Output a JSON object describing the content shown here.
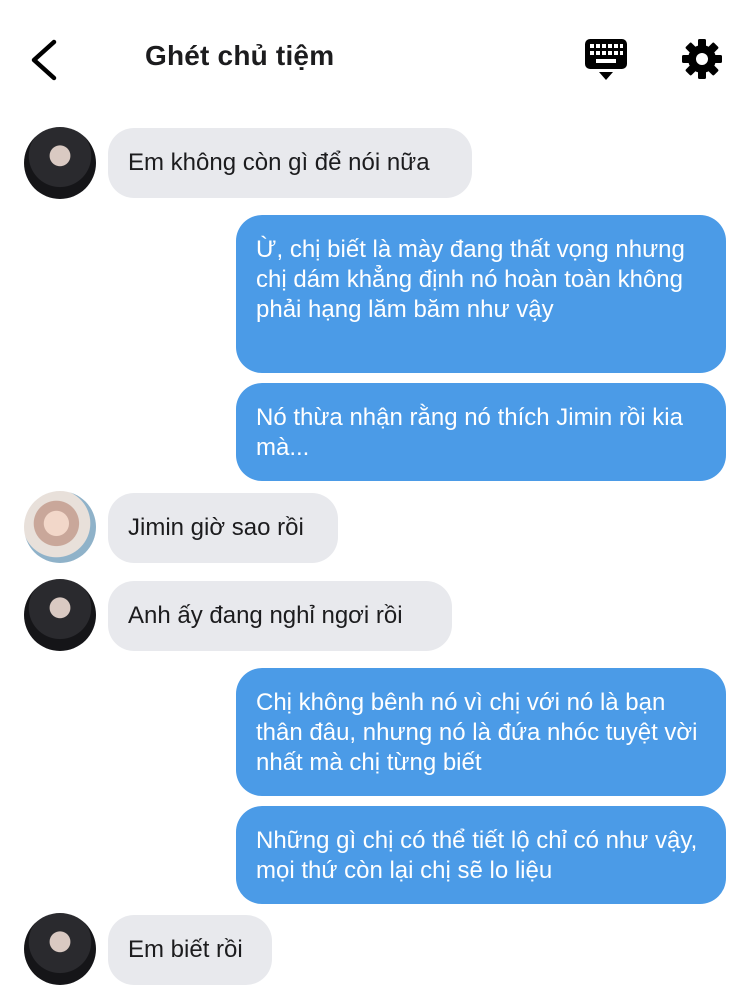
{
  "header": {
    "title": "Ghét chủ tiệm",
    "back_icon": "chevron-left-icon",
    "keyboard_icon": "keyboard-icon",
    "settings_icon": "gear-icon"
  },
  "colors": {
    "outgoing_bubble": "#4b9be7",
    "incoming_bubble": "#e8e9ed",
    "text_dark": "#1c1c1e"
  },
  "messages": [
    {
      "side": "in",
      "avatar": "girl",
      "text": "Em không còn gì để nói nữa"
    },
    {
      "side": "out",
      "text": "Ừ, chị biết là mày đang thất vọng nhưng chị dám khẳng định nó hoàn toàn không phải hạng lăm băm như vậy"
    },
    {
      "side": "out",
      "text": "Nó thừa nhận rằng nó thích Jimin rồi kia mà..."
    },
    {
      "side": "in",
      "avatar": "jimin",
      "text": "Jimin giờ sao rồi"
    },
    {
      "side": "in",
      "avatar": "girl",
      "text": "Anh ấy đang nghỉ ngơi rồi"
    },
    {
      "side": "out",
      "text": "Chị không bênh nó vì chị với nó là bạn thân đâu, nhưng nó là đứa nhóc tuyệt vời nhất mà chị từng biết"
    },
    {
      "side": "out",
      "text": "Những gì chị có thể tiết lộ chỉ có như vậy, mọi thứ còn lại chị sẽ lo liệu"
    },
    {
      "side": "in",
      "avatar": "girl",
      "text": "Em biết rồi"
    }
  ]
}
